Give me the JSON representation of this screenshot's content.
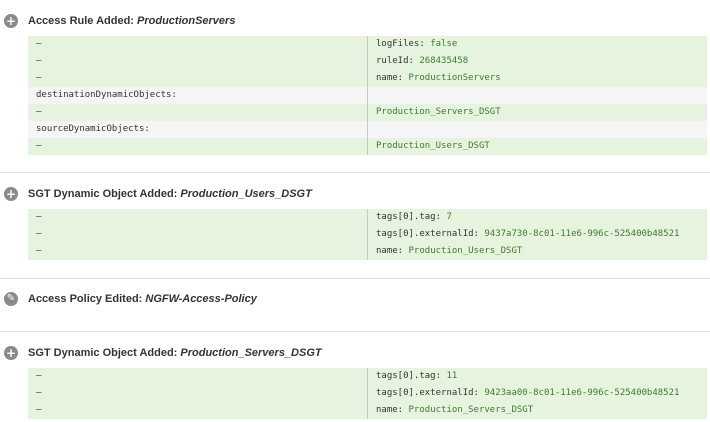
{
  "sections": [
    {
      "icon": "plus-icon",
      "title_prefix": "Access Rule Added: ",
      "title_name": "ProductionServers",
      "rows": [
        {
          "style": "green",
          "left": "–",
          "key": "logFiles: ",
          "value": "false"
        },
        {
          "style": "green",
          "left": "–",
          "key": "ruleId: ",
          "value": "268435458"
        },
        {
          "style": "green",
          "left": "–",
          "key": "name: ",
          "value": "ProductionServers"
        },
        {
          "style": "grey",
          "left": "destinationDynamicObjects:",
          "key": "",
          "value": ""
        },
        {
          "style": "green",
          "left": "–",
          "key": "",
          "value": "Production_Servers_DSGT"
        },
        {
          "style": "grey",
          "left": "sourceDynamicObjects:",
          "key": "",
          "value": ""
        },
        {
          "style": "green",
          "left": "–",
          "key": "",
          "value": "Production_Users_DSGT"
        }
      ]
    },
    {
      "icon": "plus-icon",
      "title_prefix": "SGT Dynamic Object Added: ",
      "title_name": "Production_Users_DSGT",
      "rows": [
        {
          "style": "green",
          "left": "–",
          "key": "tags[0].tag: ",
          "value": "7"
        },
        {
          "style": "green",
          "left": "–",
          "key": "tags[0].externalId: ",
          "value": "9437a730-8c01-11e6-996c-525400b48521"
        },
        {
          "style": "green",
          "left": "–",
          "key": "name: ",
          "value": "Production_Users_DSGT"
        }
      ]
    },
    {
      "icon": "pencil-icon",
      "title_prefix": "Access Policy Edited: ",
      "title_name": "NGFW-Access-Policy",
      "rows": []
    },
    {
      "icon": "plus-icon",
      "title_prefix": "SGT Dynamic Object Added: ",
      "title_name": "Production_Servers_DSGT",
      "rows": [
        {
          "style": "green",
          "left": "–",
          "key": "tags[0].tag: ",
          "value": "11"
        },
        {
          "style": "green",
          "left": "–",
          "key": "tags[0].externalId: ",
          "value": "9423aa00-8c01-11e6-996c-525400b48521"
        },
        {
          "style": "green",
          "left": "–",
          "key": "name: ",
          "value": "Production_Servers_DSGT"
        }
      ]
    }
  ]
}
